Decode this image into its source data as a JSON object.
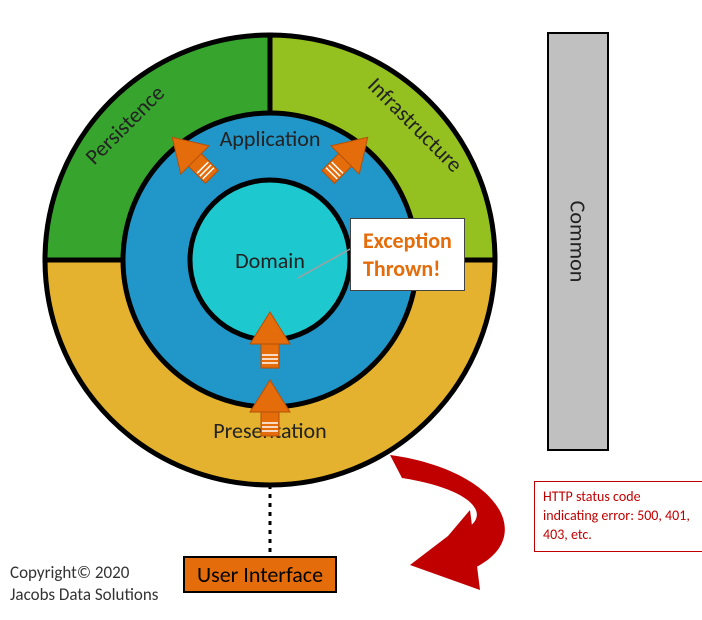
{
  "diagram": {
    "outer_ring": {
      "top_left": {
        "label": "Persistence",
        "color": "#37a52d"
      },
      "top_right": {
        "label": "Infrastructure",
        "color": "#94c11f"
      },
      "bottom": {
        "label": "Presentation",
        "color": "#e4b22e"
      }
    },
    "middle_ring": {
      "label": "Application",
      "color": "#2196c9"
    },
    "inner_circle": {
      "label": "Domain",
      "color": "#1ec8cf"
    },
    "arrows": {
      "from_persistence": "arrow-inward",
      "from_infrastructure": "arrow-inward",
      "from_domain_to_presentation": "arrow-down",
      "colors": "#e46c0a"
    },
    "callout_exception": "Exception\nThrown!",
    "dotted_line_to_ui": true,
    "user_interface_box": "User Interface",
    "common_bar": "Common",
    "red_curve_arrow": true,
    "http_box": "HTTP status code indicating error: 500, 401, 403, etc.",
    "exception_lines": [
      "Exception",
      "Thrown!"
    ]
  },
  "copyright": {
    "line1": "Copyright© 2020",
    "line2": "Jacobs Data Solutions"
  },
  "colors": {
    "arrow": "#e46c0a",
    "red": "#c00000",
    "stroke": "#000"
  }
}
